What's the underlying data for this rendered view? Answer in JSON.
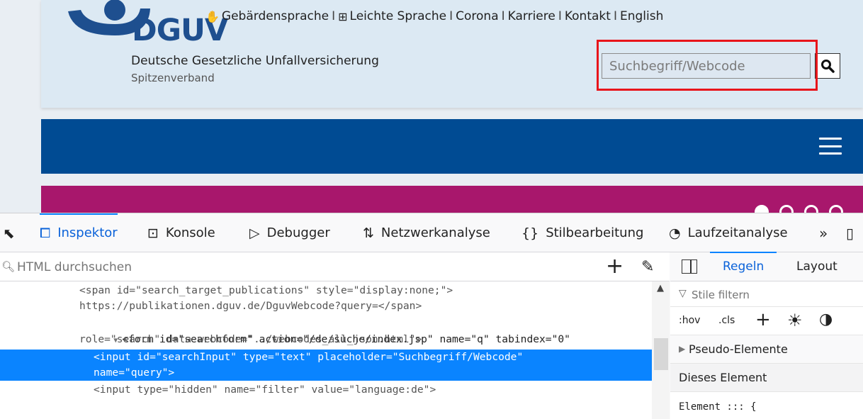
{
  "site": {
    "logo_text": "DGUV",
    "org_name": "Deutsche Gesetzliche Unfallversicherung",
    "org_sub": "Spitzenverband",
    "top_links": [
      "Gebärdensprache",
      "Leichte Sprache",
      "Corona",
      "Karriere",
      "Kontakt",
      "English"
    ],
    "link_separator": "I",
    "search_placeholder": "Suchbegriff/Webcode",
    "colors": {
      "brand_blue": "#004b93",
      "banner_magenta": "#a8176c",
      "highlight_red": "#e8151b"
    }
  },
  "devtools": {
    "tabs": [
      {
        "label": "Inspektor",
        "icon": "inspector-icon"
      },
      {
        "label": "Konsole",
        "icon": "console-icon"
      },
      {
        "label": "Debugger",
        "icon": "debugger-icon"
      },
      {
        "label": "Netzwerkanalyse",
        "icon": "network-icon"
      },
      {
        "label": "Stilbearbeitung",
        "icon": "style-editor-icon"
      },
      {
        "label": "Laufzeitanalyse",
        "icon": "performance-icon"
      }
    ],
    "html_search_placeholder": "HTML durchsuchen",
    "markup_lines": [
      "<span id=\"search_target_publications\" style=\"display:none;\">",
      "https://publikationen.dguv.de/DguvWebcode?query=</span>",
      "<form id=\"searchform\" action=\"/de/suche/index.jsp\" name=\"q\" tabindex=\"0\"",
      "role=\"search\" data-webcode=\"../webcodes_all_json.html\">",
      "<input id=\"searchInput\" type=\"text\" placeholder=\"Suchbegriff/Webcode\"",
      "name=\"query\">",
      "<input type=\"hidden\" name=\"filter\" value=\"language:de\">"
    ],
    "rules": {
      "tab_regeln": "Regeln",
      "tab_layout": "Layout",
      "filter_placeholder": "Stile filtern",
      "hov": ":hov",
      "cls": ".cls",
      "pseudo_label": "Pseudo-Elemente",
      "element_label": "Dieses Element",
      "element_rule": "Element ::: {"
    }
  }
}
